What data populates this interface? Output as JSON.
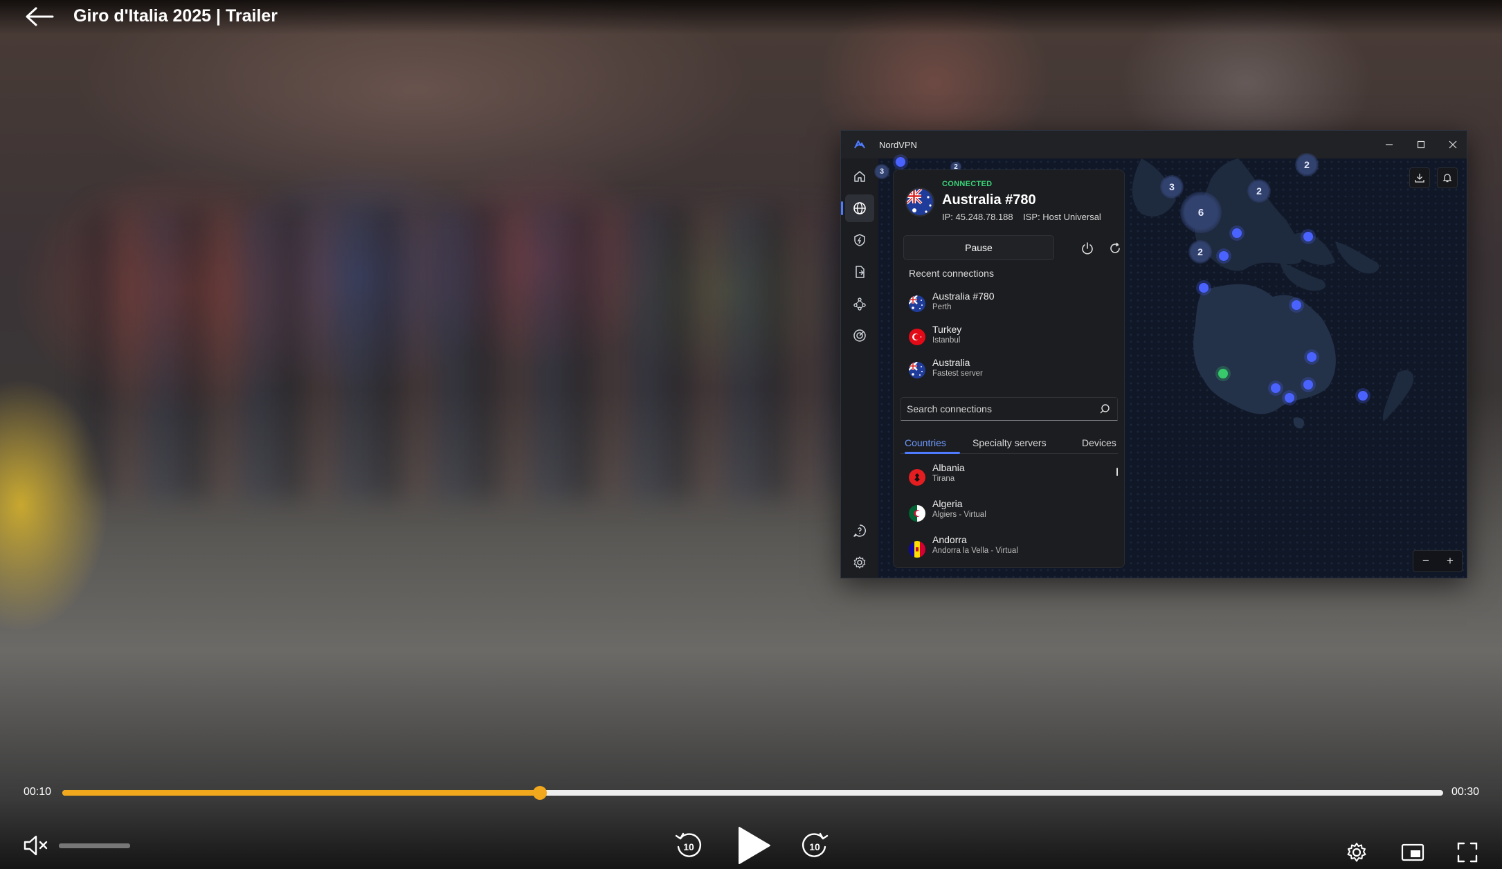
{
  "player": {
    "title": "Giro d'Italia 2025 | Trailer",
    "current_time": "00:10",
    "total_time": "00:30",
    "progress_fraction": 0.346,
    "volume_fraction": 0.0,
    "muted": true,
    "accent_color": "#f2a81d",
    "skip_back_label": "10",
    "skip_forward_label": "10",
    "icons": [
      "back-arrow-icon",
      "mute-icon",
      "rewind-10-icon",
      "play-icon",
      "forward-10-icon",
      "settings-icon",
      "picture-in-picture-icon",
      "fullscreen-icon"
    ]
  },
  "vpn": {
    "app_title": "NordVPN",
    "status": "CONNECTED",
    "status_color": "#3bd67a",
    "server": "Australia #780",
    "ip_label": "IP: 45.248.78.188",
    "isp_label": "ISP: Host Universal",
    "pause_label": "Pause",
    "recent_title": "Recent connections",
    "recent": [
      {
        "name": "Australia #780",
        "sub": "Perth",
        "flag": "australia-flag"
      },
      {
        "name": "Turkey",
        "sub": "Istanbul",
        "flag": "turkey-flag"
      },
      {
        "name": "Australia",
        "sub": "Fastest server",
        "flag": "australia-flag"
      }
    ],
    "search_placeholder": "Search connections",
    "tabs": [
      {
        "label": "Countries",
        "active": true
      },
      {
        "label": "Specialty servers",
        "active": false
      },
      {
        "label": "Devices",
        "active": false
      }
    ],
    "countries": [
      {
        "name": "Albania",
        "sub": "Tirana",
        "flag": "albania-flag"
      },
      {
        "name": "Algeria",
        "sub": "Algiers - Virtual",
        "flag": "algeria-flag"
      },
      {
        "name": "Andorra",
        "sub": "Andorra la Vella - Virtual",
        "flag": "andorra-flag"
      }
    ],
    "map_clusters": [
      "3",
      "2",
      "2",
      "6",
      "2",
      "3",
      "2"
    ],
    "zoom_out_label": "−",
    "zoom_in_label": "+",
    "sidebar_icons": [
      "home-icon",
      "globe-icon",
      "shield-icon",
      "file-share-icon",
      "meshnet-icon",
      "target-icon",
      "help-icon",
      "settings-icon"
    ]
  }
}
